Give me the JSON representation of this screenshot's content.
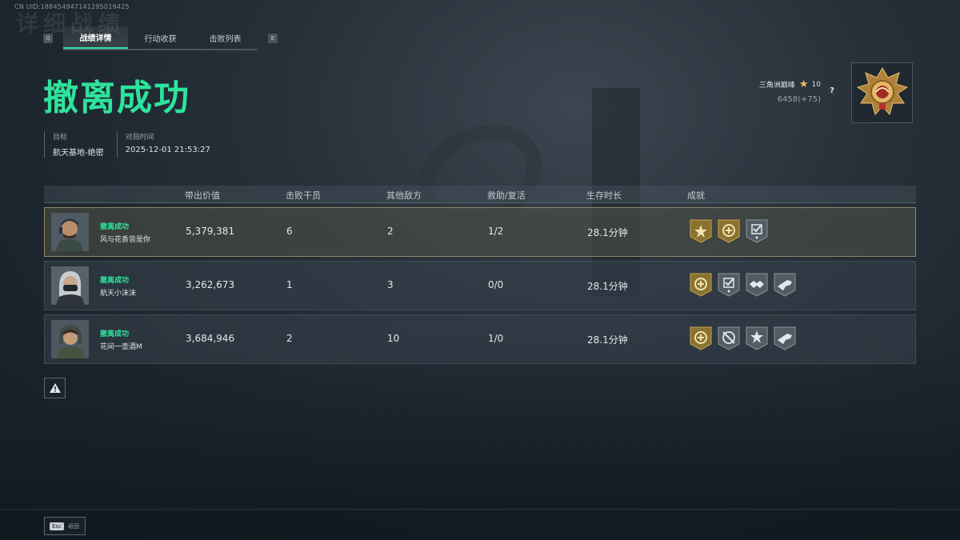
{
  "uid": "CN UID:1884549471412950194​25",
  "ghost_title": "详细战绩",
  "tabs": {
    "prev_key": "Q",
    "next_key": "E",
    "items": [
      {
        "label": "战绩详情",
        "active": true
      },
      {
        "label": "行动收获",
        "active": false
      },
      {
        "label": "击败列表",
        "active": false
      }
    ]
  },
  "result": {
    "title": "撤离成功",
    "color": "#2de49d"
  },
  "meta": {
    "target_label": "目标",
    "target_value": "航天基地-绝密",
    "time_label": "对局时间",
    "time_value": "2025-12-01 21:53:27"
  },
  "rank": {
    "name": "三角洲巅峰",
    "stars": "10",
    "points": "6458(+75)",
    "help": "?",
    "emblem_icon": "gold-rank-emblem"
  },
  "table": {
    "columns": [
      "带出价值",
      "击败干员",
      "其他敌方",
      "救助/复活",
      "生存时长",
      "成就"
    ],
    "rows": [
      {
        "status": "撤离成功",
        "name": "风与花香皆是你",
        "value": "5,379,381",
        "kills": "6",
        "other": "2",
        "rescue": "1/2",
        "survive": "28.1分钟",
        "badges": [
          "gold-star-badge",
          "gold-coin-badge",
          "gray-check-badge"
        ],
        "avatar_icon": "operator-avatar-headset",
        "is_me": true
      },
      {
        "status": "撤离成功",
        "name": "航天小沫沫",
        "value": "3,262,673",
        "kills": "1",
        "other": "3",
        "rescue": "0/0",
        "survive": "28.1分钟",
        "badges": [
          "gold-coin-badge",
          "gray-check-badge",
          "gray-handshake-badge",
          "gray-gun-badge"
        ],
        "avatar_icon": "operator-avatar-mask",
        "is_me": false
      },
      {
        "status": "撤离成功",
        "name": "花间一壶酒M",
        "value": "3,684,946",
        "kills": "2",
        "other": "10",
        "rescue": "1/0",
        "survive": "28.1分钟",
        "badges": [
          "gold-coin-badge",
          "gray-crosshair-badge",
          "gray-star-badge",
          "gray-gun-badge"
        ],
        "avatar_icon": "operator-avatar-hood",
        "is_me": false
      }
    ]
  },
  "footer": {
    "esc_key": "Esc",
    "back_label": "返回"
  },
  "colors": {
    "accent": "#2de49d",
    "gold": "#c9a24a",
    "highlight_border": "#8f8a63"
  }
}
